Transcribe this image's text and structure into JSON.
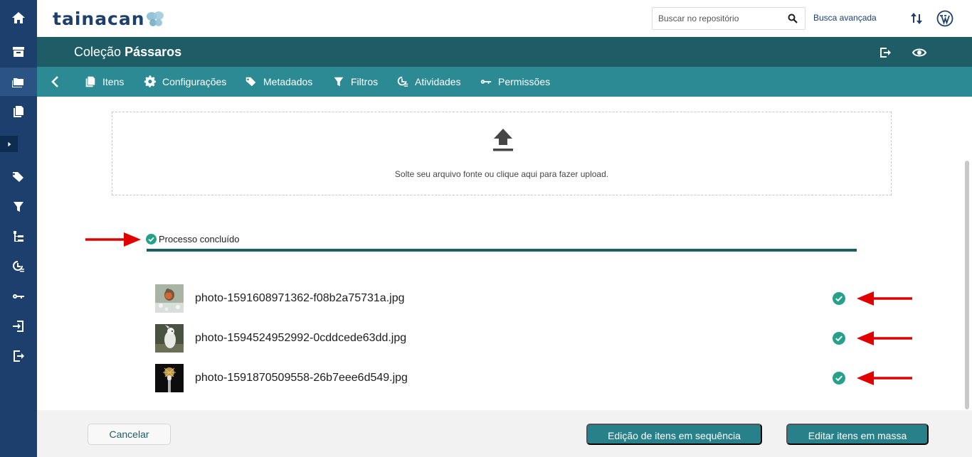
{
  "app": {
    "logo_text": "tainacan"
  },
  "header": {
    "search_placeholder": "Buscar no repositório",
    "advanced_search": "Busca avançada"
  },
  "collection": {
    "prefix": "Coleção",
    "name": "Pássaros"
  },
  "tabs": [
    {
      "label": "Itens",
      "icon": "items-icon"
    },
    {
      "label": "Configurações",
      "icon": "gear-icon"
    },
    {
      "label": "Metadados",
      "icon": "tags-icon"
    },
    {
      "label": "Filtros",
      "icon": "filter-icon"
    },
    {
      "label": "Atividades",
      "icon": "activities-icon"
    },
    {
      "label": "Permissões",
      "icon": "key-icon"
    }
  ],
  "upload": {
    "drop_text": "Solte seu arquivo fonte ou clique aqui para fazer upload."
  },
  "process": {
    "status_text": "Processo concluído",
    "progress": 1.0
  },
  "files": [
    {
      "name": "photo-1591608971362-f08b2a75731a.jpg",
      "done": true
    },
    {
      "name": "photo-1594524952992-0cddcede63dd.jpg",
      "done": true
    },
    {
      "name": "photo-1591870509558-26b7eee6d549.jpg",
      "done": true
    }
  ],
  "footer": {
    "cancel": "Cancelar",
    "sequence_edit": "Edição de itens em sequência",
    "bulk_edit": "Editar itens em massa"
  },
  "colors": {
    "sidebar": "#1d3f6e",
    "collection_bar": "#1e5d65",
    "tab_bar": "#2c8a94",
    "success": "#25a189",
    "annotation_arrow": "#e00000"
  }
}
